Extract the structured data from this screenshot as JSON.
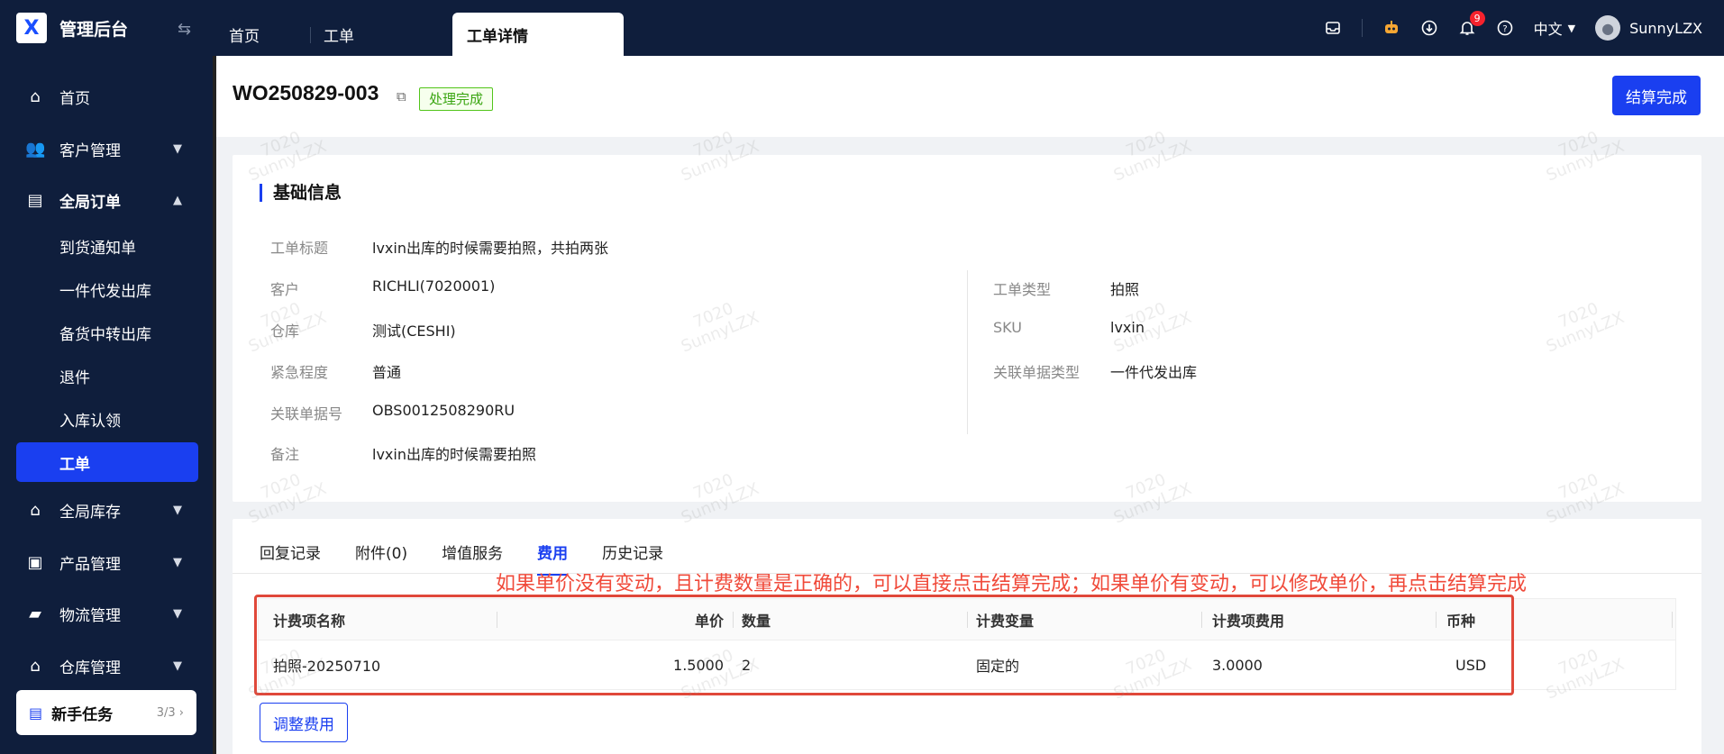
{
  "app": {
    "logo": "X",
    "title": "管理后台"
  },
  "tabs": [
    {
      "label": "首页"
    },
    {
      "label": "工单"
    },
    {
      "label": "工单详情"
    }
  ],
  "header": {
    "language": "中文",
    "username": "SunnyLZX",
    "notification_count": "9"
  },
  "sidebar": {
    "items": [
      {
        "label": "首页"
      },
      {
        "label": "客户管理"
      },
      {
        "label": "全局订单"
      },
      {
        "label": "全局库存"
      },
      {
        "label": "产品管理"
      },
      {
        "label": "物流管理"
      },
      {
        "label": "仓库管理"
      }
    ],
    "sub_items": [
      {
        "label": "到货通知单"
      },
      {
        "label": "一件代发出库"
      },
      {
        "label": "备货中转出库"
      },
      {
        "label": "退件"
      },
      {
        "label": "入库认领"
      },
      {
        "label": "工单"
      }
    ],
    "task": {
      "label": "新手任务",
      "count": "3/3"
    }
  },
  "order": {
    "number": "WO250829-003",
    "status": "处理完成",
    "settle_label": "结算完成"
  },
  "basic": {
    "title": "基础信息",
    "left": [
      {
        "label": "工单标题",
        "value": "lvxin出库的时候需要拍照，共拍两张"
      },
      {
        "label": "客户",
        "value": "RICHLI(7020001)"
      },
      {
        "label": "仓库",
        "value": "测试(CESHI)"
      },
      {
        "label": "紧急程度",
        "value": "普通"
      },
      {
        "label": "关联单据号",
        "value": "OBS0012508290RU"
      },
      {
        "label": "备注",
        "value": "lvxin出库的时候需要拍照"
      }
    ],
    "right": [
      {
        "label": "工单类型",
        "value": "拍照"
      },
      {
        "label": "SKU",
        "value": "lvxin"
      },
      {
        "label": "关联单据类型",
        "value": "一件代发出库"
      }
    ]
  },
  "fee_tabs": [
    "回复记录",
    "附件(0)",
    "增值服务",
    "费用",
    "历史记录"
  ],
  "annotation": "如果单价没有变动，且计费数量是正确的，可以直接点击结算完成；如果单价有变动，可以修改单价，再点击结算完成",
  "fee_table": {
    "headers": [
      "计费项名称",
      "单价",
      "数量",
      "计费变量",
      "计费项费用",
      "币种"
    ],
    "rows": [
      [
        "拍照-20250710",
        "1.5000",
        "2",
        "固定的",
        "3.0000",
        "USD"
      ]
    ]
  },
  "adjust_label": "调整费用",
  "watermark": {
    "line1": "7020",
    "line2": "SunnyLZX"
  }
}
